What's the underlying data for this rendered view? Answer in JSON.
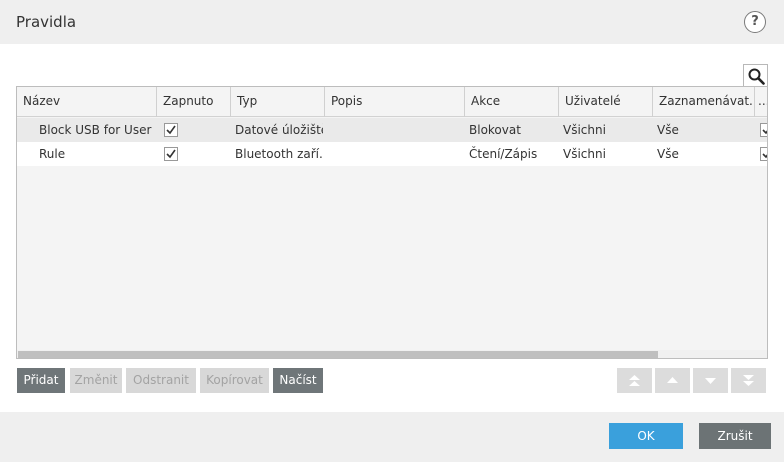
{
  "dialog": {
    "title": "Pravidla",
    "help_label": "?"
  },
  "table": {
    "columns": [
      "Název",
      "Zapnuto",
      "Typ",
      "Popis",
      "Akce",
      "Uživatelé",
      "Zaznamenávat...",
      "..."
    ],
    "rows": [
      {
        "name": "Block USB for User",
        "enabled": true,
        "type": "Datové úložiště",
        "description": "",
        "action": "Blokovat",
        "users": "Všichni",
        "log": "Vše"
      },
      {
        "name": "Rule",
        "enabled": true,
        "type": "Bluetooth zaří...",
        "description": "",
        "action": "Čtení/Zápis",
        "users": "Všichni",
        "log": "Vše"
      }
    ]
  },
  "buttons": {
    "add": "Přidat",
    "edit": "Změnit",
    "remove": "Odstranit",
    "copy": "Kopírovat",
    "load": "Načíst"
  },
  "footer": {
    "ok": "OK",
    "cancel": "Zrušit"
  },
  "colors": {
    "accent": "#3aa0dc",
    "dark_button": "#6f7679",
    "title_bg": "#efefef"
  }
}
